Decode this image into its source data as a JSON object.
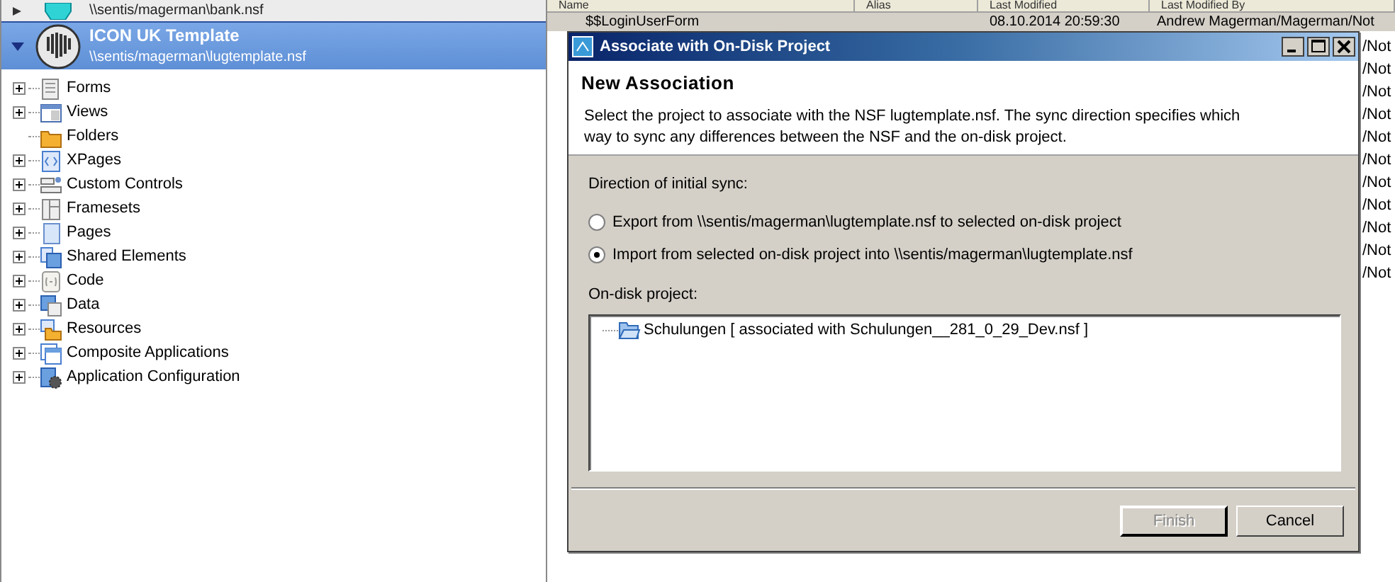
{
  "navigator": {
    "databases": [
      {
        "path": "\\\\sentis/magerman\\bank.nsf",
        "selected": false,
        "expanded": false
      },
      {
        "title": "ICON UK Template",
        "path": "\\\\sentis/magerman\\lugtemplate.nsf",
        "selected": true,
        "expanded": true
      }
    ],
    "items": [
      {
        "label": "Forms",
        "expandable": true
      },
      {
        "label": "Views",
        "expandable": true
      },
      {
        "label": "Folders",
        "expandable": false
      },
      {
        "label": "XPages",
        "expandable": true
      },
      {
        "label": "Custom Controls",
        "expandable": true
      },
      {
        "label": "Framesets",
        "expandable": true
      },
      {
        "label": "Pages",
        "expandable": true
      },
      {
        "label": "Shared Elements",
        "expandable": true
      },
      {
        "label": "Code",
        "expandable": true
      },
      {
        "label": "Data",
        "expandable": true
      },
      {
        "label": "Resources",
        "expandable": true
      },
      {
        "label": "Composite Applications",
        "expandable": true
      },
      {
        "label": "Application Configuration",
        "expandable": true
      }
    ]
  },
  "table": {
    "columns": [
      "Name",
      "Alias",
      "Last Modified",
      "Last Modified By"
    ],
    "rows": [
      {
        "cells": [
          "$$LoginUserForm",
          "",
          "08.10.2014 20:59:30",
          "Andrew Magerman/Magerman/Not"
        ],
        "selected": true
      }
    ],
    "visible_fragments": [
      "/Not",
      "/Not",
      "/Not",
      "/Not",
      "/Not",
      "/Not",
      "/Not",
      "/Not",
      "/Not",
      "/Not",
      "/Not"
    ]
  },
  "dialog": {
    "title": "Associate with On-Disk Project",
    "heading": "New Association",
    "description": "Select the project to associate with the NSF lugtemplate.nsf. The sync direction specifies which way to sync any differences between the NSF and the on-disk project.",
    "direction_label": "Direction of initial sync:",
    "options": [
      {
        "label": "Export from \\\\sentis/magerman\\lugtemplate.nsf to selected on-disk project",
        "selected": false
      },
      {
        "label": "Import from selected on-disk project into \\\\sentis/magerman\\lugtemplate.nsf",
        "selected": true
      }
    ],
    "project_label": "On-disk project:",
    "projects": [
      {
        "label": "Schulungen [ associated with Schulungen__281_0_29_Dev.nsf ]"
      }
    ],
    "buttons": [
      {
        "label": "Finish",
        "disabled": true
      },
      {
        "label": "Cancel",
        "disabled": false
      }
    ]
  }
}
